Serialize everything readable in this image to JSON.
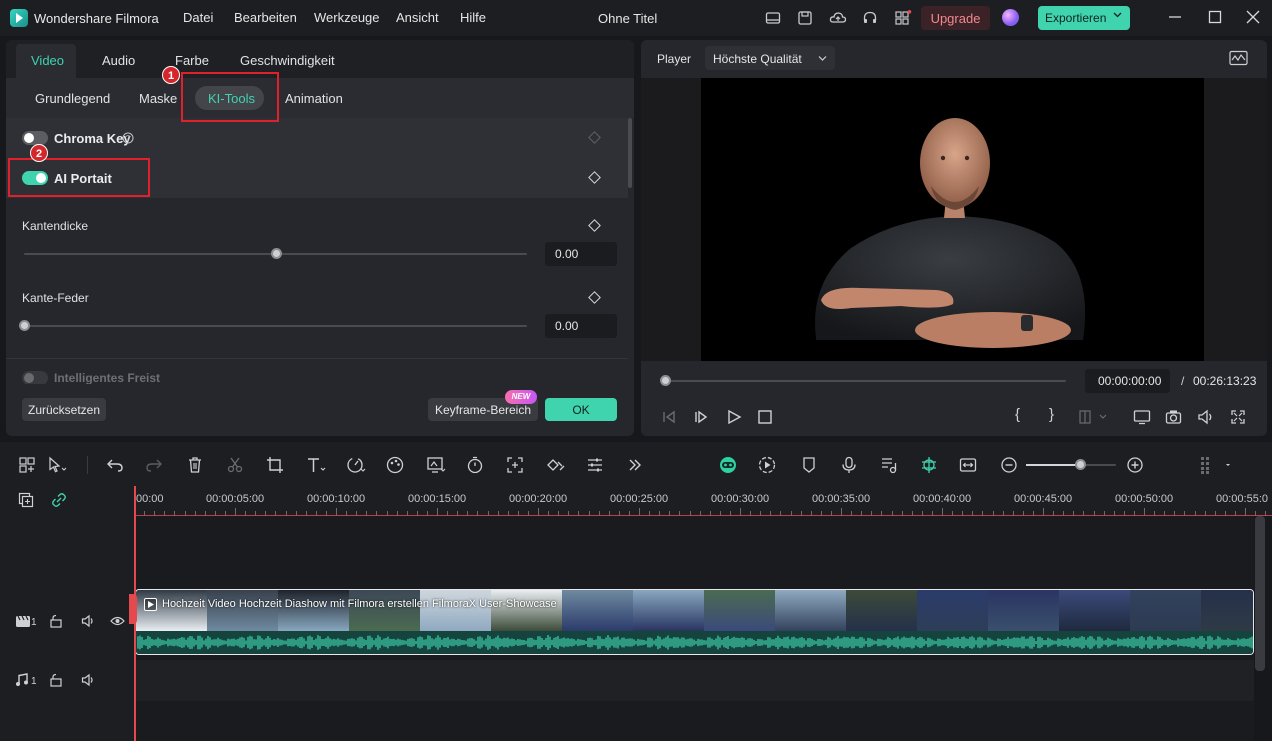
{
  "app": {
    "name": "Wondershare Filmora",
    "project_title": "Ohne Titel"
  },
  "menu": [
    "Datei",
    "Bearbeiten",
    "Werkzeuge",
    "Ansicht",
    "Hilfe"
  ],
  "titlebar": {
    "upgrade_label": "Upgrade",
    "export_label": "Exportieren"
  },
  "props": {
    "tabs": [
      "Video",
      "Audio",
      "Farbe",
      "Geschwindigkeit"
    ],
    "active_tab": "Video",
    "subtabs": [
      "Grundlegend",
      "Maske",
      "KI-Tools",
      "Animation"
    ],
    "active_subtab": "KI-Tools",
    "chroma_key": {
      "label": "Chroma Key",
      "enabled": false
    },
    "ai_portrait": {
      "label": "AI Portait",
      "enabled": true
    },
    "edge_thickness": {
      "label": "Kantendicke",
      "value": "0.00",
      "level": 0.5
    },
    "edge_feather": {
      "label": "Kante-Feder",
      "value": "0.00",
      "level": 0.0
    },
    "smart_cutout": {
      "label": "Intelligentes Freist"
    },
    "reset_label": "Zurücksetzen",
    "keyframe_label": "Keyframe-Bereich",
    "new_badge": "NEW",
    "ok_label": "OK"
  },
  "annotations": [
    "1",
    "2"
  ],
  "player": {
    "label": "Player",
    "quality": "Höchste Qualität",
    "current_time": "00:00:00:00",
    "separator": "/",
    "total_time": "00:26:13:23",
    "progress": 0.0
  },
  "timeline": {
    "ruler": [
      "00:00",
      "00:00:05:00",
      "00:00:10:00",
      "00:00:15:00",
      "00:00:20:00",
      "00:00:25:00",
      "00:00:30:00",
      "00:00:35:00",
      "00:00:40:00",
      "00:00:45:00",
      "00:00:50:00",
      "00:00:55:0"
    ],
    "clip_titles": [
      "Hochzeit Video",
      "Hochzeit Diashow mit Filmora erstellen",
      "FilmoraX User-Showcase"
    ],
    "video_track_label": "1",
    "audio_track_label": "1",
    "zoom_level": 0.6
  },
  "colors": {
    "accent": "#3fd4ae",
    "playhead": "#e5484d",
    "upgrade_bg": "#3b2226",
    "upgrade_text": "#f08a8f"
  }
}
